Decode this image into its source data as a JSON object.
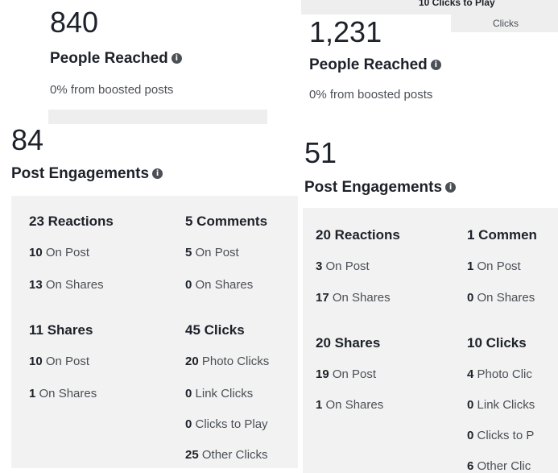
{
  "left": {
    "reached_count": "840",
    "reached_label": "People Reached",
    "reached_sub": "0% from boosted posts",
    "engagements_count": "84",
    "engagements_label": "Post Engagements",
    "reactions": {
      "head": "23 Reactions",
      "post_num": "10",
      "post_label": "On Post",
      "shares_num": "13",
      "shares_label": "On Shares"
    },
    "comments": {
      "head": "5 Comments",
      "post_num": "5",
      "post_label": "On Post",
      "shares_num": "0",
      "shares_label": "On Shares"
    },
    "shares": {
      "head": "11 Shares",
      "post_num": "10",
      "post_label": "On Post",
      "shares_num": "1",
      "shares_label": "On Shares"
    },
    "clicks": {
      "head": "45 Clicks",
      "items": [
        {
          "num": "20",
          "label": "Photo Clicks"
        },
        {
          "num": "0",
          "label": "Link Clicks"
        },
        {
          "num": "0",
          "label": "Clicks to Play"
        },
        {
          "num": "25",
          "label": "Other Clicks"
        }
      ]
    }
  },
  "right": {
    "top_partial_1": "10 Clicks to Play",
    "top_partial_2": "Clicks",
    "reached_count": "1,231",
    "reached_label": "People Reached",
    "reached_sub": "0% from boosted posts",
    "engagements_count": "51",
    "engagements_label": "Post Engagements",
    "reactions": {
      "head": "20 Reactions",
      "post_num": "3",
      "post_label": "On Post",
      "shares_num": "17",
      "shares_label": "On Shares"
    },
    "comments": {
      "head": "1 Commen",
      "post_num": "1",
      "post_label": "On Post",
      "shares_num": "0",
      "shares_label": "On Shares"
    },
    "shares": {
      "head": "20 Shares",
      "post_num": "19",
      "post_label": "On Post",
      "shares_num": "1",
      "shares_label": "On Shares"
    },
    "clicks": {
      "head": "10 Clicks",
      "items": [
        {
          "num": "4",
          "label": "Photo Clic"
        },
        {
          "num": "0",
          "label": "Link Clicks"
        },
        {
          "num": "0",
          "label": "Clicks to P"
        },
        {
          "num": "6",
          "label": "Other Clic"
        }
      ]
    }
  },
  "icons": {
    "info": "info-icon"
  }
}
